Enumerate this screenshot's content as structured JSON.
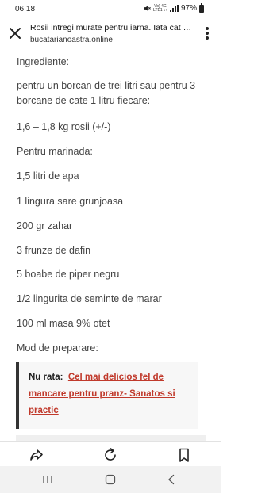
{
  "status_bar": {
    "time": "06:18",
    "network_top": "Vo) 4G",
    "network_bottom": "LTE1 ↓↑",
    "battery": "97%"
  },
  "header": {
    "title": "Rosii intregi murate pentru iarna. Iata cat de us...",
    "domain": "bucatarianoastra.online",
    "close_icon": "close-icon",
    "menu_icon": "more-vert-icon"
  },
  "article": {
    "paragraphs": [
      "Ingrediente:",
      "pentru un borcan de trei litri sau pentru 3 borcane de cate 1 litru fiecare:",
      "1,6 – 1,8 kg rosii (+/-)",
      "Pentru marinada:",
      "1,5 litri de apa",
      "1 lingura sare grunjoasa",
      "200 gr zahar",
      "3 frunze de dafin",
      "5 boabe de piper negru",
      "1/2 lingurita de seminte de marar",
      "100 ml masa 9% otet",
      "Mod de preparare:"
    ],
    "quote": {
      "prefix": "Nu rata:",
      "link_text": "Cel mai delicios fel de mancare pentru pranz- Sanatos si practic"
    }
  },
  "toolbar": {
    "share_icon": "share-icon",
    "refresh_icon": "refresh-icon",
    "bookmark_icon": "bookmark-icon"
  },
  "navbar": {
    "recents_icon": "recents-icon",
    "home_icon": "home-icon",
    "back_icon": "back-icon"
  },
  "colors": {
    "text": "#444444",
    "link": "#c0392b",
    "quote_border": "#333333",
    "navbar_bg": "#f2f2f2"
  }
}
